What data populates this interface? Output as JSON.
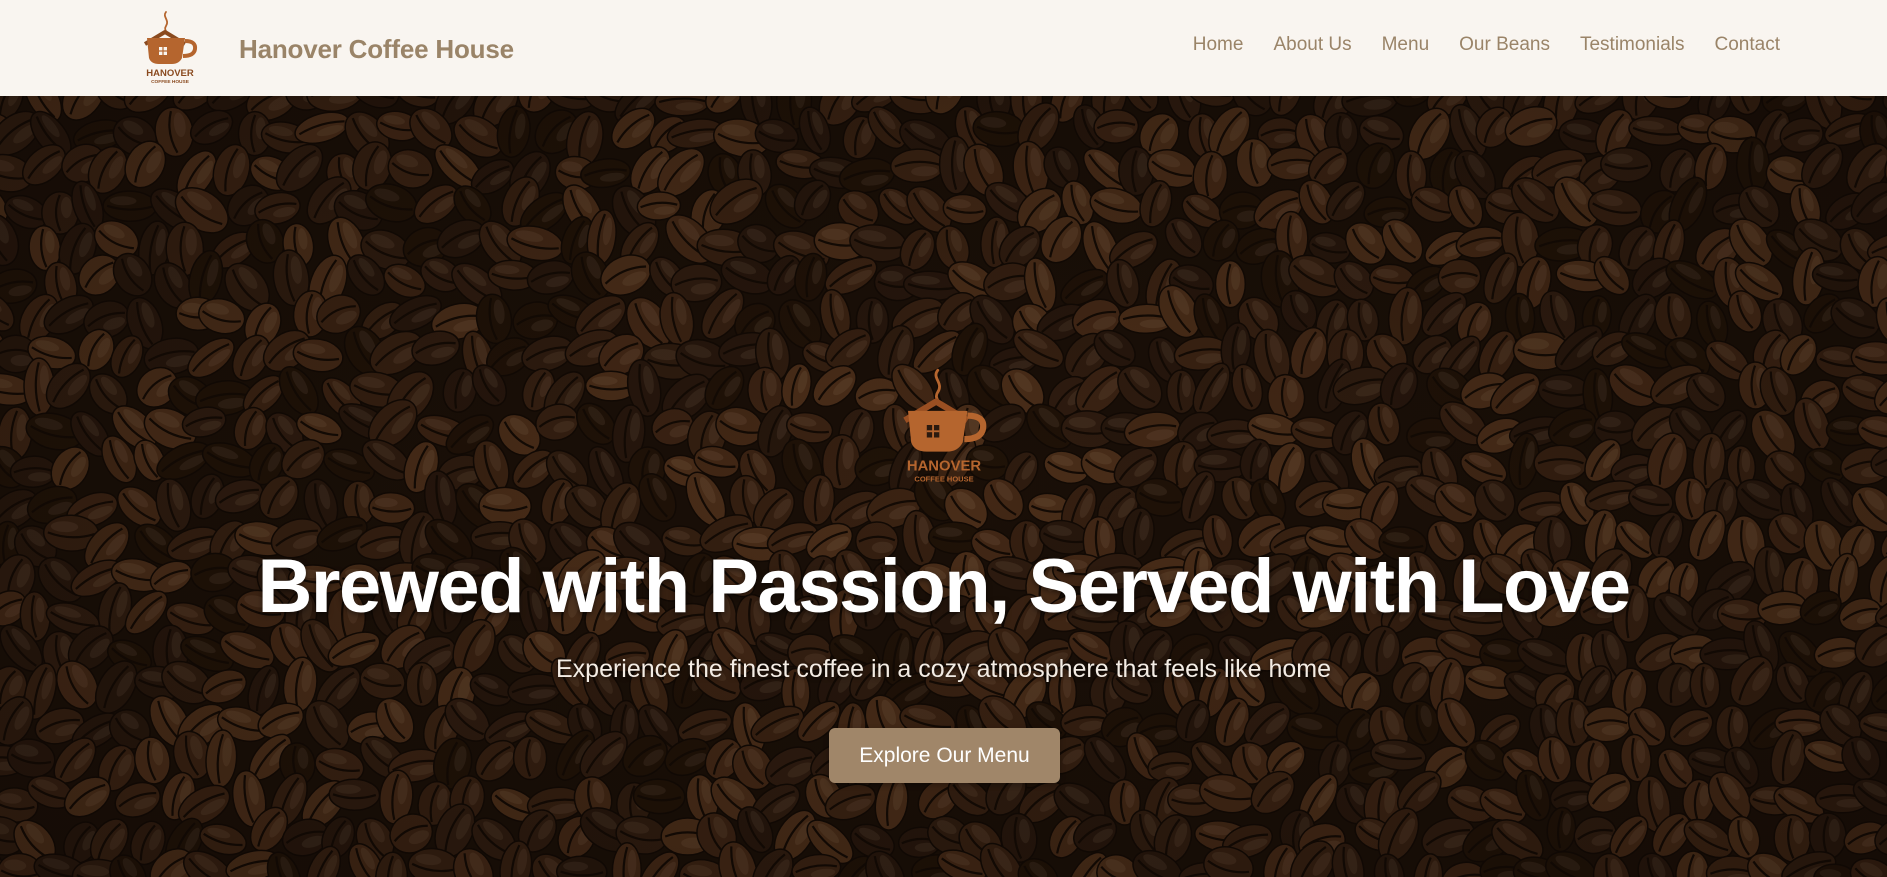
{
  "brand": {
    "name": "Hanover Coffee House",
    "logo_text": "HANOVER",
    "logo_subtext": "COFFEE HOUSE"
  },
  "nav": {
    "items": [
      {
        "label": "Home"
      },
      {
        "label": "About Us"
      },
      {
        "label": "Menu"
      },
      {
        "label": "Our Beans"
      },
      {
        "label": "Testimonials"
      },
      {
        "label": "Contact"
      }
    ]
  },
  "hero": {
    "title": "Brewed with Passion, Served with Love",
    "subtitle": "Experience the finest coffee in a cozy atmosphere that feels like home",
    "cta_label": "Explore Our Menu",
    "background": "coffee-beans-image"
  },
  "colors": {
    "header_bg": "#f9f5f0",
    "brand_text": "#9a8468",
    "logo_brown": "#b5652e",
    "cta_bg": "#a08669",
    "hero_text": "#ffffff"
  }
}
